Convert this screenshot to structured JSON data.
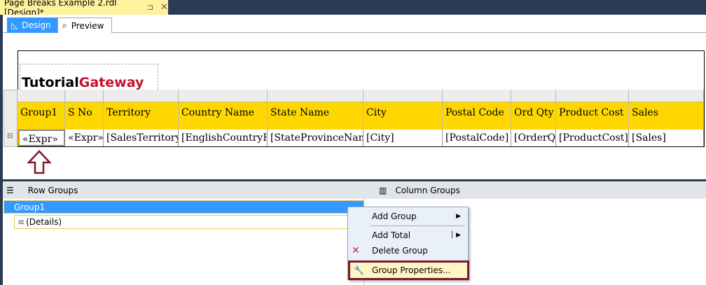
{
  "document_tab": {
    "title": "Page Breaks Example 2.rdl [Design]*",
    "pin": "⊐",
    "close": "✕"
  },
  "view_tabs": [
    {
      "label": "Design"
    },
    {
      "label": "Preview"
    }
  ],
  "logo": {
    "part1": "Tutorial",
    "part2": "Gateway"
  },
  "table": {
    "headers": [
      "Group1",
      "S No",
      "Territory",
      "Country Name",
      "State Name",
      "City",
      "Postal Code",
      "Ord Qty",
      "Product Cost",
      "Sales"
    ],
    "row": [
      "«Expr»",
      "«Expr»",
      "[SalesTerritory",
      "[EnglishCountryR",
      "[StateProvinceNam",
      "[City]",
      "[PostalCode]",
      "[OrderQt",
      "[ProductCost]",
      "[Sales]"
    ]
  },
  "groups": {
    "row_title": "Row Groups",
    "column_title": "Column Groups",
    "items": [
      "Group1",
      "(Details)"
    ]
  },
  "context_menu": {
    "items": [
      "Add Group",
      "Add Total",
      "Delete Group",
      "Group Properties..."
    ]
  },
  "colors": {
    "accent": "#3399ff",
    "header_yellow": "#ffd700",
    "highlight_border": "#7b1a2b"
  }
}
